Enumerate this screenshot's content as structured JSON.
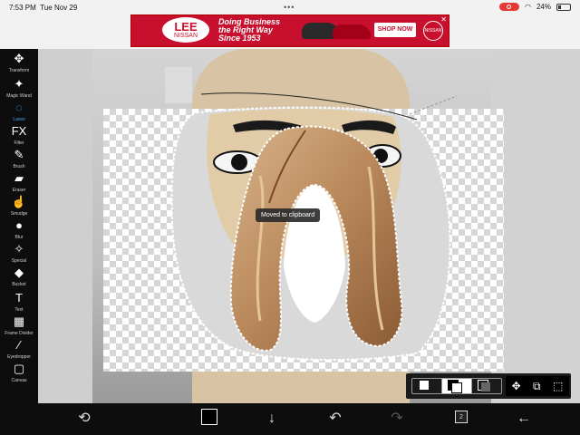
{
  "status_bar": {
    "time": "7:53 PM",
    "date": "Tue Nov 29",
    "battery": "24%"
  },
  "ad": {
    "logo_main": "LEE",
    "logo_sub": "NISSAN",
    "line1": "Doing Business",
    "line2": "the Right Way",
    "line3": "Since 1953",
    "cta": "SHOP NOW",
    "brand": "NISSAN",
    "close_glyph": "✕"
  },
  "toolbar": {
    "items": [
      {
        "label": "Transform",
        "icon": "✥"
      },
      {
        "label": "Magic Wand",
        "icon": "✦"
      },
      {
        "label": "Lasso",
        "icon": "◌"
      },
      {
        "label": "Filter",
        "icon": "FX"
      },
      {
        "label": "Brush",
        "icon": "✎"
      },
      {
        "label": "Eraser",
        "icon": "▰"
      },
      {
        "label": "Smudge",
        "icon": "☝"
      },
      {
        "label": "Blur",
        "icon": "●"
      },
      {
        "label": "Special",
        "icon": "✧"
      },
      {
        "label": "Bucket",
        "icon": "◆"
      },
      {
        "label": "Text",
        "icon": "T"
      },
      {
        "label": "Frame Divider",
        "icon": "▦"
      },
      {
        "label": "Eyedropper",
        "icon": "⁄"
      },
      {
        "label": "Canvas",
        "icon": "▢"
      }
    ],
    "active_index": 2
  },
  "canvas": {
    "toast": "Moved to clipboard"
  },
  "selection_panel": {
    "move_icon": "✥",
    "select_icon": "⧉",
    "deselect_icon": "⬚"
  },
  "bottom_bar": {
    "adjust_icon": "⟲",
    "download_icon": "↓",
    "undo_icon": "↶",
    "redo_icon": "↷",
    "layers_count": "2",
    "back_icon": "←"
  },
  "colors": {
    "active_tool": "#4aa3ff",
    "primary_color": "#000000",
    "ad_red": "#c8102e"
  }
}
